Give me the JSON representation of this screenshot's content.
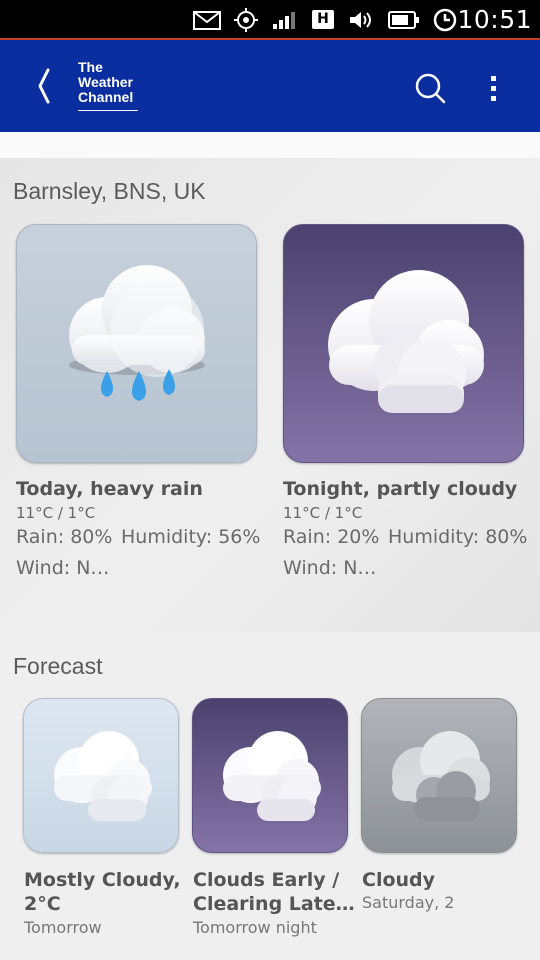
{
  "status_bar": {
    "icons": [
      "mail-icon",
      "location-target-icon",
      "signal-icon",
      "hspa-icon",
      "volume-icon",
      "battery-icon",
      "alarm-icon"
    ],
    "hspa_label": "H",
    "time": "10:51"
  },
  "header": {
    "logo": [
      "The",
      "Weather",
      "Channel"
    ],
    "bg_color": "#0a2da0"
  },
  "location": {
    "title": "Barnsley, BNS, UK",
    "today": {
      "title": "Today, heavy rain",
      "temp": "11°C / 1°C",
      "rain": "Rain: 80%",
      "humidity": "Humidity: 56%",
      "wind": "Wind: N…",
      "icon": "heavy-rain-icon"
    },
    "tonight": {
      "title": "Tonight, partly cloudy",
      "temp": "11°C / 1°C",
      "rain": "Rain: 20%",
      "humidity": "Humidity: 80%",
      "wind": "Wind: N…",
      "icon": "partly-cloudy-night-icon"
    }
  },
  "forecast": {
    "title": "Forecast",
    "items": [
      {
        "title": "Mostly Cloudy, 2°C",
        "sub": "Tomorrow",
        "icon": "mostly-cloudy-icon"
      },
      {
        "title": "Clouds Early / Clearing Late…",
        "sub": "Tomorrow night",
        "icon": "clouds-clearing-icon"
      },
      {
        "title": "Cloudy",
        "sub": "Saturday, 2",
        "icon": "cloudy-icon"
      }
    ]
  }
}
